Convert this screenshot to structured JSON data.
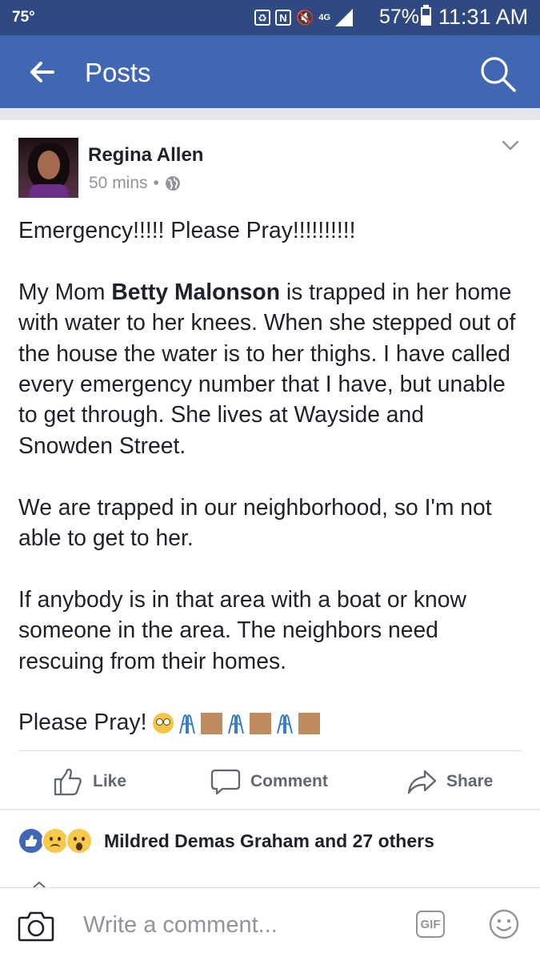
{
  "status_bar": {
    "temperature": "75°",
    "battery_percent": "57%",
    "battery_level": 0.57,
    "time": "11:31 AM",
    "icons": [
      "screenshot-icon",
      "nfc-icon",
      "mute-icon",
      "data-4g-icon",
      "signal-icon",
      "battery-icon"
    ],
    "network_label": "4G"
  },
  "app_bar": {
    "title": "Posts",
    "color": "#4267b2",
    "back_icon": "back-arrow-icon",
    "search_icon": "search-icon"
  },
  "post": {
    "author": "Regina Allen",
    "time": "50 mins",
    "separator": "•",
    "privacy_icon": "globe-icon",
    "paragraphs": {
      "p1": "Emergency!!!!!  Please Pray!!!!!!!!!!",
      "p2_before": "My Mom ",
      "p2_bold": "Betty Malonson",
      "p2_after": " is trapped in her home with water to her knees. When she stepped out of the house the water is to her thighs. I have called every emergency number that I have, but unable to get through. She lives at Wayside and Snowden Street.",
      "p3": "We are trapped in our neighborhood, so I'm not able to get to her.",
      "p4": "If anybody is in that area with a boat or know someone in the area. The neighbors need rescuing from their homes.",
      "p5": "Please Pray!"
    },
    "emojis": [
      "flushed-face",
      "folded-hands",
      "skin-tone-modifier",
      "folded-hands",
      "skin-tone-modifier",
      "folded-hands",
      "skin-tone-modifier"
    ]
  },
  "actions": {
    "like": "Like",
    "comment": "Comment",
    "share": "Share"
  },
  "reactions": {
    "types": [
      "like",
      "sad",
      "wow"
    ],
    "summary": "Mildred Demas Graham and 27 others"
  },
  "comment_bar": {
    "placeholder": "Write a comment...",
    "gif_label": "GIF",
    "camera_icon": "camera-icon",
    "sticker_icon": "smiley-icon"
  }
}
